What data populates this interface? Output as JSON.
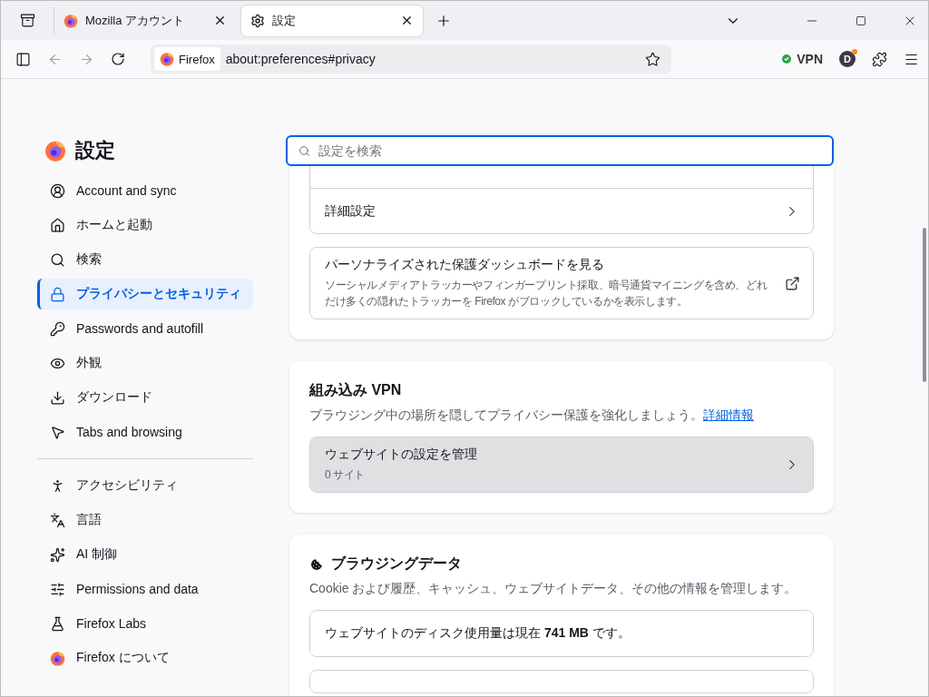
{
  "tabs": [
    {
      "kind": "site",
      "label": "Mozilla アカウント",
      "selected": false
    },
    {
      "kind": "settings",
      "label": "設定",
      "selected": true
    }
  ],
  "toolbar": {
    "identity": "Firefox",
    "url": "about:preferences#privacy",
    "vpn": "VPN",
    "avatar": "D"
  },
  "sidebar": {
    "title": "設定",
    "groups": [
      [
        {
          "label": "Account and sync",
          "selected": false
        },
        {
          "label": "ホームと起動",
          "selected": false
        },
        {
          "label": "検索",
          "selected": false
        },
        {
          "label": "プライバシーとセキュリティ",
          "selected": true
        },
        {
          "label": "Passwords and autofill",
          "selected": false
        },
        {
          "label": "外観",
          "selected": false
        },
        {
          "label": "ダウンロード",
          "selected": false
        },
        {
          "label": "Tabs and browsing",
          "selected": false
        }
      ],
      [
        {
          "label": "アクセシビリティ",
          "selected": false
        },
        {
          "label": "言語",
          "selected": false
        },
        {
          "label": "AI 制御",
          "selected": false
        },
        {
          "label": "Permissions and data",
          "selected": false
        },
        {
          "label": "Firefox Labs",
          "selected": false
        },
        {
          "label": "Firefox について",
          "selected": false
        }
      ]
    ]
  },
  "search": {
    "placeholder": "設定を検索"
  },
  "cards": [
    {
      "rows": [
        {
          "kind": "blank"
        },
        {
          "kind": "nav",
          "title": "詳細設定"
        }
      ],
      "gap_rows": [
        {
          "kind": "external",
          "title": "パーソナライズされた保護ダッシュボードを見る",
          "description": "ソーシャルメディアトラッカーやフィンガープリント採取、暗号通貨マイニングを含め、どれだけ多くの隠れたトラッカーを Firefox がブロックしているかを表示します。"
        }
      ]
    },
    {
      "heading": "組み込み VPN",
      "description": "ブラウジング中の場所を隠してプライバシー保護を強化しましょう。",
      "link": "詳細情報",
      "gap_rows": [
        {
          "kind": "nav",
          "title": "ウェブサイトの設定を管理",
          "subtitle": "0 サイト",
          "highlighted": true
        }
      ]
    },
    {
      "heading": "ブラウジングデータ",
      "description": "Cookie および履歴、キャッシュ、ウェブサイトデータ、その他の情報を管理します。",
      "gap_rows": [
        {
          "kind": "text",
          "title": "ウェブサイトのディスク使用量は現在 **741 MB** です。"
        },
        {
          "kind": "blank"
        }
      ]
    }
  ]
}
